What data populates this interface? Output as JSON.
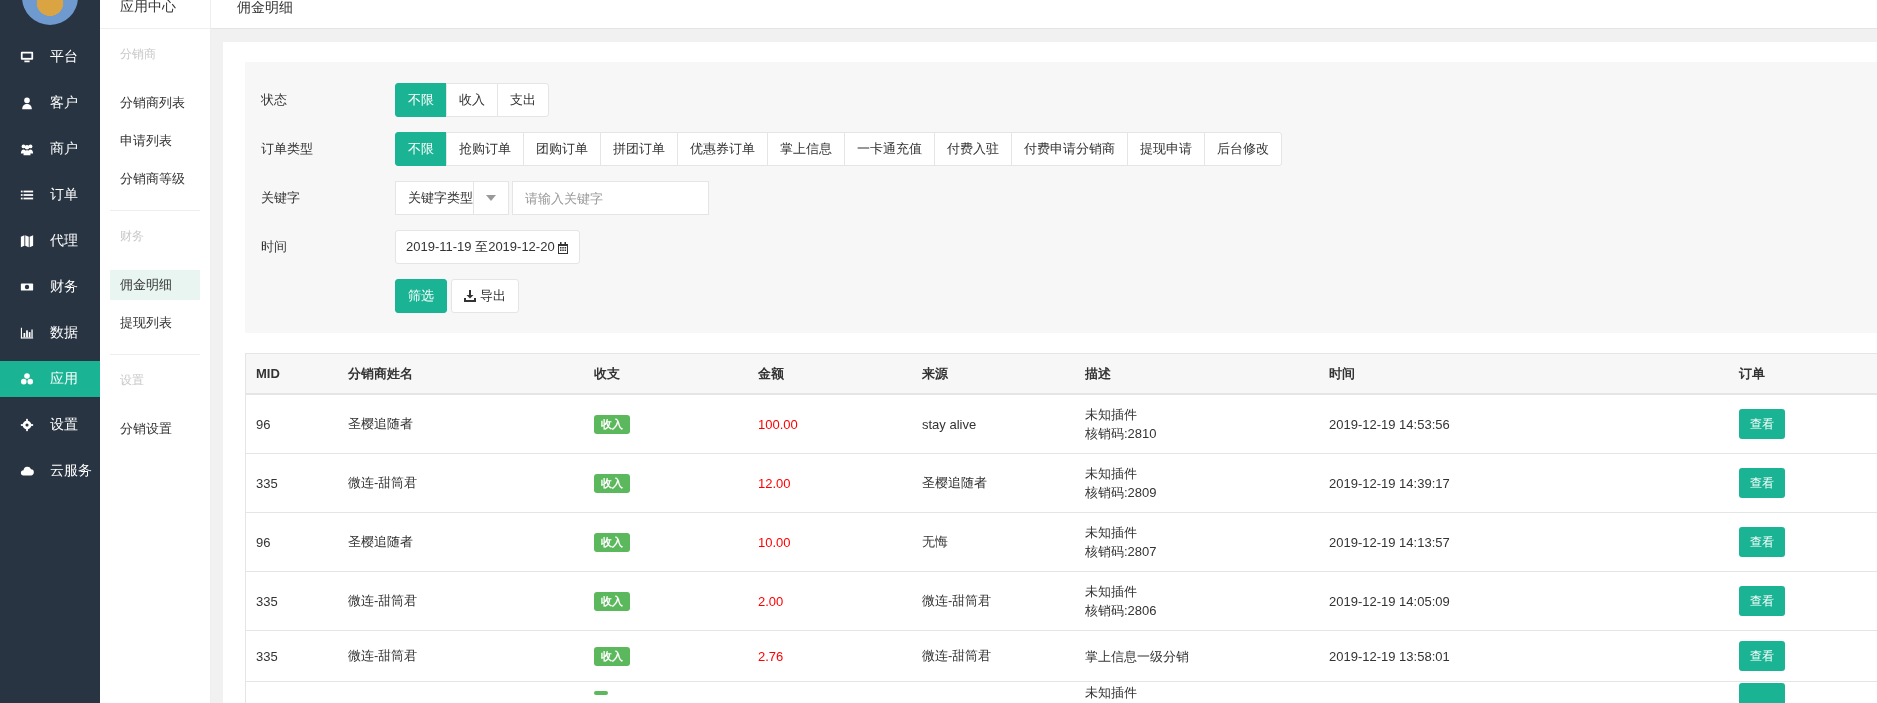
{
  "nav": {
    "items": [
      {
        "label": "平台",
        "selected": false
      },
      {
        "label": "客户",
        "selected": false
      },
      {
        "label": "商户",
        "selected": false
      },
      {
        "label": "订单",
        "selected": false
      },
      {
        "label": "代理",
        "selected": false
      },
      {
        "label": "财务",
        "selected": false
      },
      {
        "label": "数据",
        "selected": false
      },
      {
        "label": "应用",
        "selected": true
      },
      {
        "label": "设置",
        "selected": false
      },
      {
        "label": "云服务",
        "selected": false
      }
    ]
  },
  "subnav": {
    "title": "应用中心",
    "groups": [
      {
        "heading": "分销商",
        "items": [
          {
            "label": "分销商列表",
            "selected": false
          },
          {
            "label": "申请列表",
            "selected": false
          },
          {
            "label": "分销商等级",
            "selected": false
          }
        ]
      },
      {
        "heading": "财务",
        "items": [
          {
            "label": "佣金明细",
            "selected": true
          },
          {
            "label": "提现列表",
            "selected": false
          }
        ]
      },
      {
        "heading": "设置",
        "items": [
          {
            "label": "分销设置",
            "selected": false
          }
        ]
      }
    ]
  },
  "header": {
    "title": "佣金明细"
  },
  "filters": [
    {
      "kind": "options",
      "label": "状态",
      "options": [
        {
          "label": "不限",
          "selected": true
        },
        {
          "label": "收入",
          "selected": false
        },
        {
          "label": "支出",
          "selected": false
        }
      ]
    },
    {
      "kind": "options",
      "label": "订单类型",
      "options": [
        {
          "label": "不限",
          "selected": true
        },
        {
          "label": "抢购订单",
          "selected": false
        },
        {
          "label": "团购订单",
          "selected": false
        },
        {
          "label": "拼团订单",
          "selected": false
        },
        {
          "label": "优惠券订单",
          "selected": false
        },
        {
          "label": "掌上信息",
          "selected": false
        },
        {
          "label": "一卡通充值",
          "selected": false
        },
        {
          "label": "付费入驻",
          "selected": false
        },
        {
          "label": "付费申请分销商",
          "selected": false
        },
        {
          "label": "提现申请",
          "selected": false
        },
        {
          "label": "后台修改",
          "selected": false
        }
      ]
    },
    {
      "kind": "keyword",
      "label": "关键字",
      "select": "关键字类型",
      "placeholder": "请输入关键字"
    },
    {
      "kind": "date",
      "label": "时间",
      "value": "2019-11-19 至2019-12-20"
    }
  ],
  "actions": [
    {
      "kind": "primary",
      "label": "筛选"
    },
    {
      "kind": "export",
      "label": "导出"
    }
  ],
  "table": {
    "columns": [
      "MID",
      "分销商姓名",
      "收支",
      "金额",
      "来源",
      "描述",
      "时间",
      "订单"
    ],
    "rows": [
      {
        "mid": "96",
        "name": "圣樱追随者",
        "type": "收入",
        "amount": "100.00",
        "source": "stay alive",
        "desc": [
          "未知插件",
          "核销码:2810"
        ],
        "time": "2019-12-19 14:53:56",
        "action": "查看"
      },
      {
        "mid": "335",
        "name": "微连-甜筒君",
        "type": "收入",
        "amount": "12.00",
        "source": "圣樱追随者",
        "desc": [
          "未知插件",
          "核销码:2809"
        ],
        "time": "2019-12-19 14:39:17",
        "action": "查看"
      },
      {
        "mid": "96",
        "name": "圣樱追随者",
        "type": "收入",
        "amount": "10.00",
        "source": "无悔",
        "desc": [
          "未知插件",
          "核销码:2807"
        ],
        "time": "2019-12-19 14:13:57",
        "action": "查看"
      },
      {
        "mid": "335",
        "name": "微连-甜筒君",
        "type": "收入",
        "amount": "2.00",
        "source": "微连-甜筒君",
        "desc": [
          "未知插件",
          "核销码:2806"
        ],
        "time": "2019-12-19 14:05:09",
        "action": "查看"
      },
      {
        "mid": "335",
        "name": "微连-甜筒君",
        "type": "收入",
        "amount": "2.76",
        "source": "微连-甜筒君",
        "desc": [
          "掌上信息一级分销"
        ],
        "time": "2019-12-19 13:58:01",
        "action": "查看"
      },
      {
        "desc": [
          "未知插件"
        ]
      }
    ]
  }
}
